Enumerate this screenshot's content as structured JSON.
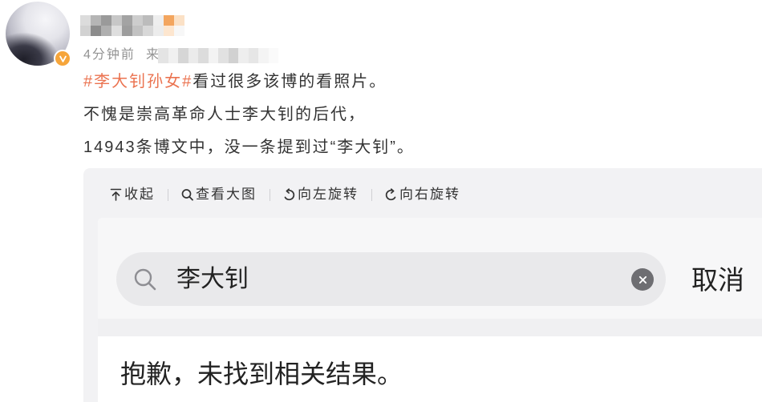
{
  "post": {
    "time": "4分钟前",
    "source_prefix": "来",
    "topic": "#李大钊孙女#",
    "line1_rest": "看过很多该博的看照片。",
    "line2": "不愧是崇高革命人士李大钊的后代，",
    "line3": "14943条博文中，没一条提到过“李大钊”。"
  },
  "image_viewer": {
    "toolbar": [
      {
        "label": "收起",
        "icon": "collapse-arrow-up-icon"
      },
      {
        "label": "查看大图",
        "icon": "magnifier-icon"
      },
      {
        "label": "向左旋转",
        "icon": "rotate-left-icon"
      },
      {
        "label": "向右旋转",
        "icon": "rotate-right-icon"
      }
    ],
    "image": {
      "search_query": "李大钊",
      "cancel_label": "取消",
      "empty_result": "抱歉，未找到相关结果。"
    }
  },
  "icons": {
    "avatar": "user-avatar",
    "verified": "verified-v-badge-icon",
    "search": "search-icon",
    "clear": "clear-circle-icon"
  },
  "colors": {
    "topic_link": "#eb7350",
    "body_text": "#333333",
    "meta_text": "#939393",
    "verified_badge": "#f6a53a",
    "viewer_background": "#f2f2f4",
    "search_pill": "#e9e9eb"
  }
}
